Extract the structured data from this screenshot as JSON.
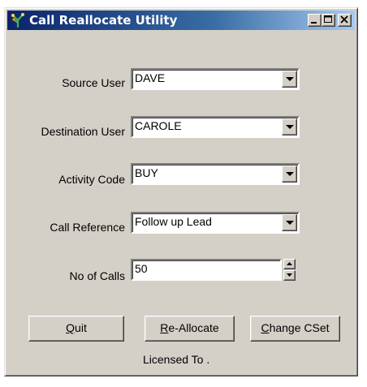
{
  "window": {
    "title": "Call Reallocate Utility"
  },
  "form": {
    "fields": [
      {
        "label": "Source User",
        "value": "DAVE"
      },
      {
        "label": "Destination User",
        "value": "CAROLE"
      },
      {
        "label": "Activity Code",
        "value": "BUY"
      },
      {
        "label": "Call Reference",
        "value": "Follow up Lead"
      }
    ],
    "calls": {
      "label": "No of Calls",
      "value": "50"
    }
  },
  "buttons": {
    "quit": {
      "mnemonic": "Q",
      "rest": "uit"
    },
    "reallocate": {
      "mnemonic": "R",
      "rest": "e-Allocate"
    },
    "change_cset": {
      "mnemonic": "C",
      "rest": "hange CSet"
    }
  },
  "footer": {
    "licensed": "Licensed To ."
  },
  "colors": {
    "face": "#d4d0c8",
    "title_start": "#0a246a",
    "title_end": "#a6caf0"
  }
}
